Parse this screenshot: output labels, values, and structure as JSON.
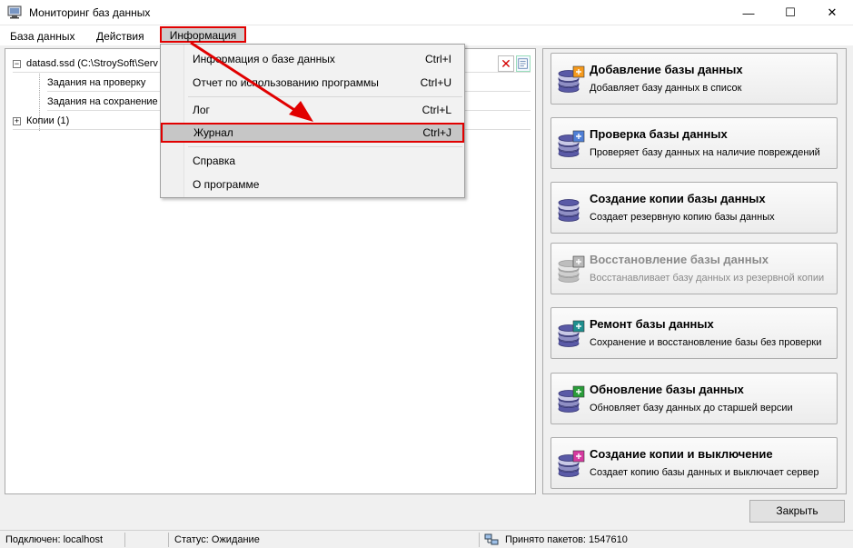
{
  "window": {
    "title": "Мониторинг баз данных",
    "minimize": "—",
    "maximize": "☐",
    "close": "✕"
  },
  "menubar": {
    "database": "База данных",
    "actions": "Действия",
    "information": "Информация"
  },
  "tree": {
    "root": "datasd.ssd (C:\\StroySoft\\Serv",
    "children": [
      "Задания на проверку",
      "Задания на сохранение"
    ],
    "copies": "Копии (1)",
    "remove": "✕"
  },
  "dropdown": {
    "items": [
      {
        "label": "Информация о базе данных",
        "shortcut": "Ctrl+I"
      },
      {
        "label": "Отчет по использованию программы",
        "shortcut": "Ctrl+U"
      },
      {
        "label": "Лог",
        "shortcut": "Ctrl+L"
      },
      {
        "label": "Журнал",
        "shortcut": "Ctrl+J"
      },
      {
        "label": "Справка",
        "shortcut": ""
      },
      {
        "label": "О программе",
        "shortcut": ""
      }
    ]
  },
  "actions": [
    {
      "title": "Добавление базы данных",
      "desc": "Добавляет базу данных в список",
      "badge_color": "#f59a1d",
      "enabled": true
    },
    {
      "title": "Проверка базы данных",
      "desc": "Проверяет базу данных на наличие повреждений",
      "badge_color": "#4f7fd6",
      "enabled": true
    },
    {
      "title": "Создание копии базы данных",
      "desc": "Создает резервную копию базы данных",
      "badge_color": "",
      "enabled": true
    },
    {
      "title": "Восстановление базы данных",
      "desc": "Восстанавливает базу данных из резервной копии",
      "badge_color": "#b8b8b8",
      "enabled": false
    },
    {
      "title": "Ремонт базы данных",
      "desc": "Сохранение и восстановление базы без проверки",
      "badge_color": "#1f8f8f",
      "enabled": true
    },
    {
      "title": "Обновление базы данных",
      "desc": "Обновляет базу данных до старшей версии",
      "badge_color": "#2a9d3a",
      "enabled": true
    },
    {
      "title": "Создание копии и выключение",
      "desc": "Создает копию базы данных и выключает сервер",
      "badge_color": "#d63aa0",
      "enabled": true
    }
  ],
  "close_button": "Закрыть",
  "status": {
    "connected": "Подключен: localhost",
    "state": "Статус: Ожидание",
    "packets": "Принято пакетов: 1547610"
  },
  "colors": {
    "highlight": "#e10000"
  }
}
